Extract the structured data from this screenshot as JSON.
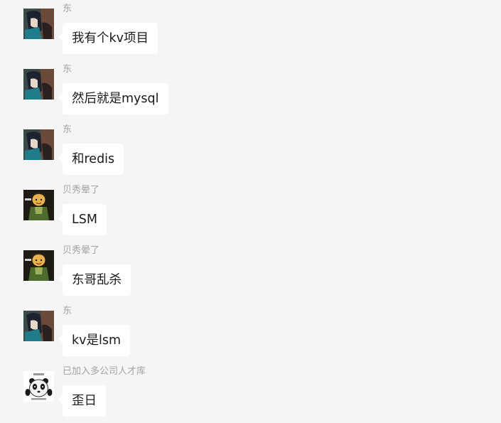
{
  "messages": [
    {
      "sender": "东",
      "text": "我有个kv项目",
      "avatar": "anime-dark-hair-avatar"
    },
    {
      "sender": "东",
      "text": "然后就是mysql",
      "avatar": "anime-dark-hair-avatar"
    },
    {
      "sender": "东",
      "text": "和redis",
      "avatar": "anime-dark-hair-avatar"
    },
    {
      "sender": "贝秀晕了",
      "text": "LSM",
      "avatar": "cartoon-kid-meme-avatar"
    },
    {
      "sender": "贝秀晕了",
      "text": "东哥乱杀",
      "avatar": "cartoon-kid-meme-avatar"
    },
    {
      "sender": "东",
      "text": "kv是lsm",
      "avatar": "anime-dark-hair-avatar"
    },
    {
      "sender": "已加入多公司人才库",
      "text": "歪日",
      "avatar": "panda-meme-avatar"
    }
  ]
}
